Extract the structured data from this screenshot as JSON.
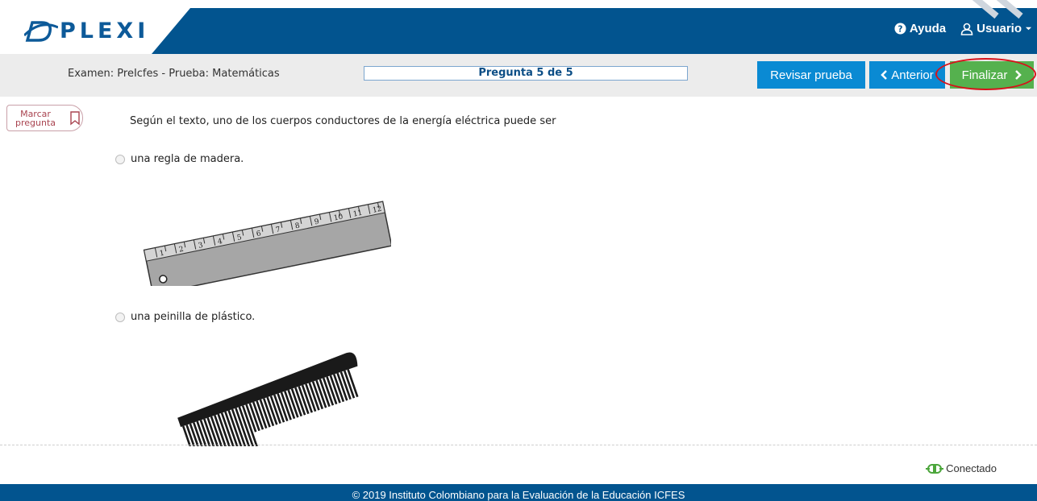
{
  "header": {
    "logo_text": "PLEXI",
    "help_label": "Ayuda",
    "user_label": "Usuario"
  },
  "subheader": {
    "exam_title": "Examen: PreIcfes - Prueba: Matemáticas",
    "question_indicator": "Pregunta 5 de 5",
    "review_label": "Revisar prueba",
    "previous_label": "Anterior",
    "finish_label": "Finalizar"
  },
  "question": {
    "mark_label_line1": "Marcar",
    "mark_label_line2": "pregunta",
    "text": "Según el texto, uno de los cuerpos conductores de la energía eléctrica puede ser",
    "options": [
      {
        "label": "una regla de madera.",
        "image": "wooden-ruler"
      },
      {
        "label": "una peinilla de plástico.",
        "image": "plastic-comb"
      }
    ]
  },
  "ruler_numbers": [
    "1",
    "2",
    "3",
    "4",
    "5",
    "6",
    "7",
    "8",
    "9",
    "10",
    "11",
    "12"
  ],
  "status": {
    "label": "Conectado"
  },
  "footer": {
    "text": "© 2019 Instituto Colombiano para la Evaluación de la Educación ICFES"
  },
  "colors": {
    "brand_blue": "#02548f",
    "button_blue": "#0a8ad3",
    "button_green": "#55b14e",
    "highlight_red": "#d6121a"
  }
}
